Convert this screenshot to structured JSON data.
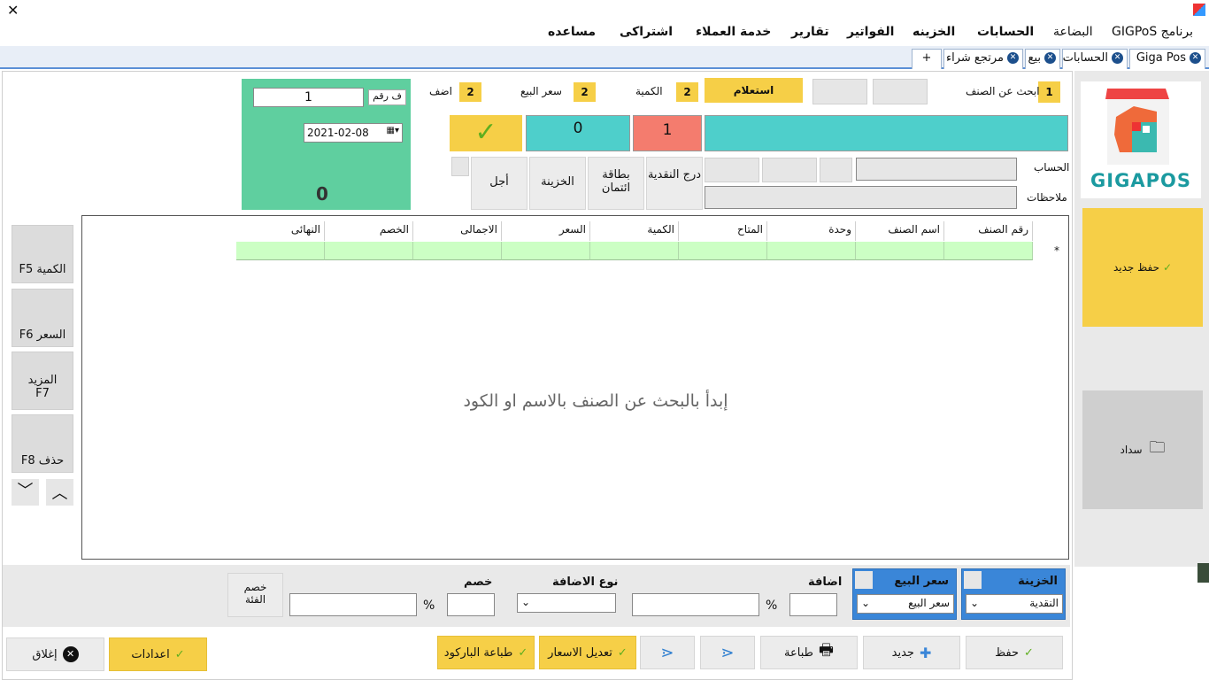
{
  "window": {
    "close_glyph": "✕"
  },
  "menu": [
    {
      "label": "برنامج GIGPoS",
      "bold": false
    },
    {
      "label": "البضاعة",
      "bold": false
    },
    {
      "label": "الحسابات",
      "bold": true
    },
    {
      "label": "الخزينه",
      "bold": true
    },
    {
      "label": "الفواتير",
      "bold": true
    },
    {
      "label": "تقارير",
      "bold": true
    },
    {
      "label": "خدمة العملاء",
      "bold": true
    },
    {
      "label": "اشتراكى",
      "bold": true
    },
    {
      "label": "مساعده",
      "bold": true
    }
  ],
  "tabs": [
    {
      "label": "Giga Pos"
    },
    {
      "label": "الحسابات"
    },
    {
      "label": "بيع"
    },
    {
      "label": "مرتجع شراء"
    },
    {
      "label": "+"
    }
  ],
  "top": {
    "search_label": "ابحث عن الصنف",
    "search_num": "1",
    "inquiry_button": "استعلام",
    "qty_label": "الكمية",
    "qty_num": "2",
    "price_label": "سعر البيع",
    "price_num": "2",
    "add_label": "اضف",
    "add_num": "2",
    "qty_value": "1",
    "price_value": "0",
    "account_label": "الحساب",
    "notes_label": "ملاحظات",
    "pay_buttons": [
      "درج النقدية",
      "بطاقة ائتمان",
      "الخزينة",
      "أجل"
    ]
  },
  "green_panel": {
    "number_label": "ف رقم",
    "number_value": "1",
    "date_value": "2021-02-08",
    "total": "0"
  },
  "logo": {
    "text": "GIGAPOS"
  },
  "right": {
    "save_new": "حفظ جديد",
    "pay": "سداد"
  },
  "grid": {
    "columns": [
      "رقم الصنف",
      "اسم الصنف",
      "وحدة",
      "المتاح",
      "الكمية",
      "السعر",
      "الاجمالى",
      "الخصم",
      "النهائى"
    ],
    "row_marker": "*",
    "empty_message": "إبدأ بالبحث عن الصنف بالاسم او الكود"
  },
  "left_buttons": [
    {
      "label": "الكمية F5"
    },
    {
      "label": "السعر F6"
    },
    {
      "label": "المزيد F7"
    },
    {
      "label": "حذف F8"
    }
  ],
  "bottom": {
    "treasury_label": "الخزينة",
    "treasury_value": "النقدية",
    "price_label": "سعر البيع",
    "price_value": "سعر البيع",
    "addition_label": "اضافة",
    "addition_type_label": "نوع الاضافة",
    "discount_label": "خصم",
    "percent": "%",
    "category_discount": "خصم الفئة"
  },
  "footer": {
    "save": "حفظ",
    "new": "جديد",
    "print": "طباعة",
    "edit_prices": "تعديل الاسعار",
    "print_barcode": "طباعة الباركود",
    "settings": "اعدادات",
    "close": "إغلاق"
  },
  "colors": {
    "accent_yellow": "#f6cf47",
    "teal": "#4ecfcb",
    "salmon": "#f47c6e",
    "green_panel": "#5fcf9f",
    "blue": "#3a86d8",
    "grid_row": "#ccffc4"
  }
}
